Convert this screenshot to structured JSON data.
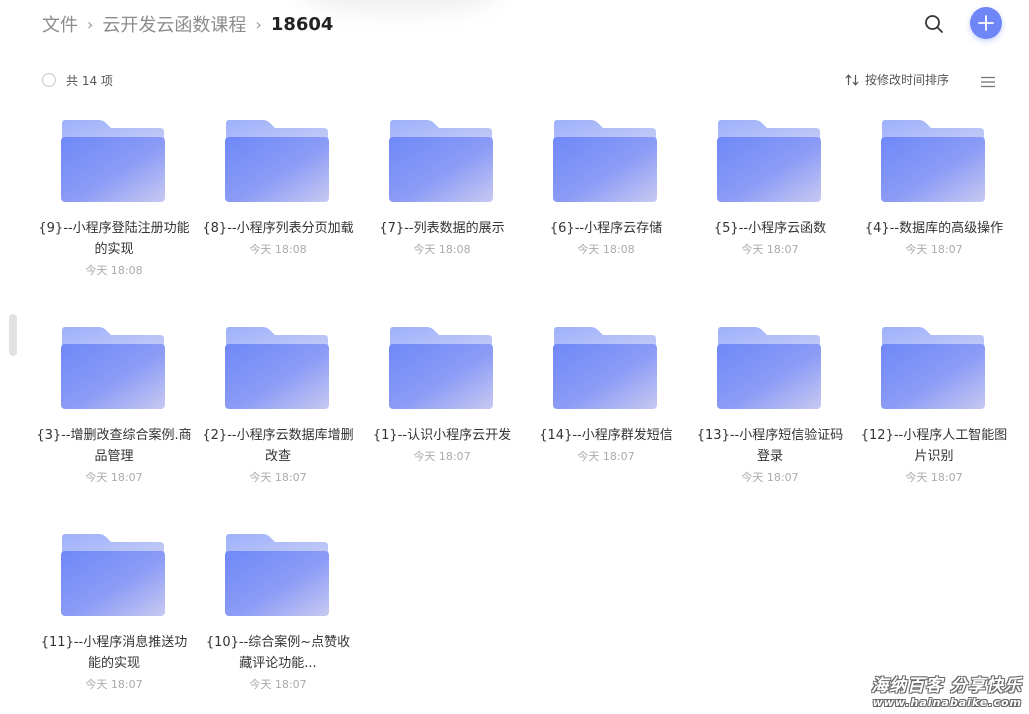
{
  "breadcrumb": {
    "items": [
      "文件",
      "云开发云函数课程"
    ],
    "current": "18604",
    "separator": "›"
  },
  "header": {
    "search_icon": "search-icon",
    "add_icon": "plus-icon",
    "accent_color": "#6f86f7"
  },
  "toolbar": {
    "count_label": "共 14 项",
    "sort_label": "按修改时间排序",
    "menu_icon": "hamburger-icon"
  },
  "files": [
    {
      "name": "{9}--小程序登陆注册功能的实现",
      "time": "今天 18:08"
    },
    {
      "name": "{8}--小程序列表分页加载",
      "time": "今天 18:08"
    },
    {
      "name": "{7}--列表数据的展示",
      "time": "今天 18:08"
    },
    {
      "name": "{6}--小程序云存储",
      "time": "今天 18:08"
    },
    {
      "name": "{5}--小程序云函数",
      "time": "今天 18:07"
    },
    {
      "name": "{4}--数据库的高级操作",
      "time": "今天 18:07"
    },
    {
      "name": "{3}--增删改查综合案例.商品管理",
      "time": "今天 18:07"
    },
    {
      "name": "{2}--小程序云数据库增删改查",
      "time": "今天 18:07"
    },
    {
      "name": "{1}--认识小程序云开发",
      "time": "今天 18:07"
    },
    {
      "name": "{14}--小程序群发短信",
      "time": "今天 18:07"
    },
    {
      "name": "{13}--小程序短信验证码登录",
      "time": "今天 18:07"
    },
    {
      "name": "{12}--小程序人工智能图片识别",
      "time": "今天 18:07"
    },
    {
      "name": "{11}--小程序消息推送功能的实现",
      "time": "今天 18:07"
    },
    {
      "name": "{10}--综合案例~点赞收藏评论功能...",
      "time": "今天 18:07"
    }
  ],
  "watermark": {
    "line1": "海纳百客 分享快乐",
    "line2": "www.hainabaike.com"
  }
}
